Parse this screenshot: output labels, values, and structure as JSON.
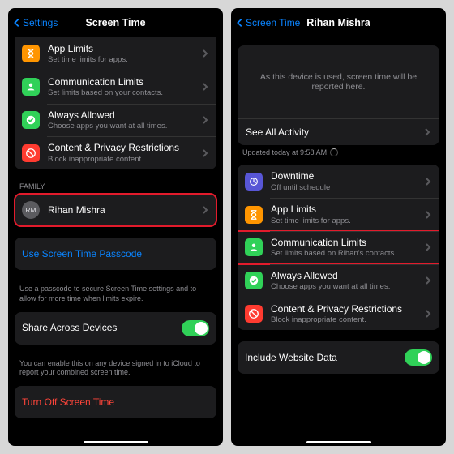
{
  "left": {
    "back": "Settings",
    "title": "Screen Time",
    "items": {
      "app_limits": {
        "title": "App Limits",
        "sub": "Set time limits for apps."
      },
      "comm_limits": {
        "title": "Communication Limits",
        "sub": "Set limits based on your contacts."
      },
      "always": {
        "title": "Always Allowed",
        "sub": "Choose apps you want at all times."
      },
      "content": {
        "title": "Content & Privacy Restrictions",
        "sub": "Block inappropriate content."
      }
    },
    "family_header": "FAMILY",
    "family_member": {
      "initials": "RM",
      "name": "Rihan Mishra"
    },
    "passcode": "Use Screen Time Passcode",
    "passcode_footer": "Use a passcode to secure Screen Time settings and to allow for more time when limits expire.",
    "share": "Share Across Devices",
    "share_footer": "You can enable this on any device signed in to iCloud to report your combined screen time.",
    "turn_off": "Turn Off Screen Time"
  },
  "right": {
    "back": "Screen Time",
    "title": "Rihan Mishra",
    "info": "As this device is used, screen time will be reported here.",
    "see_all": "See All Activity",
    "updated": "Updated today at 9:58 AM",
    "items": {
      "downtime": {
        "title": "Downtime",
        "sub": "Off until schedule"
      },
      "app_limits": {
        "title": "App Limits",
        "sub": "Set time limits for apps."
      },
      "comm_limits": {
        "title": "Communication Limits",
        "sub": "Set limits based on Rihan's contacts."
      },
      "always": {
        "title": "Always Allowed",
        "sub": "Choose apps you want at all times."
      },
      "content": {
        "title": "Content & Privacy Restrictions",
        "sub": "Block inappropriate content."
      }
    },
    "website": "Include Website Data"
  }
}
